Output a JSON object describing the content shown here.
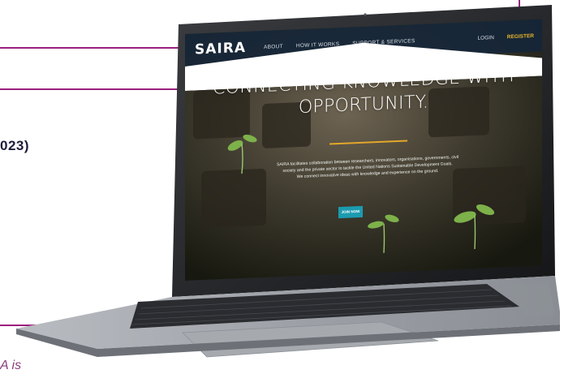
{
  "slide": {
    "year_fragment": "023)",
    "caption_fragment": "A is"
  },
  "website": {
    "logo": "SAIRA",
    "nav": {
      "items": [
        "ABOUT",
        "HOW IT WORKS",
        "SUPPORT & SERVICES"
      ],
      "login": "LOGIN",
      "register": "REGISTER"
    },
    "hero": {
      "title_line1": "CONNECTING KNOWLEDGE WITH",
      "title_line2": "OPPORTUNITY.",
      "description_line1": "SAIRA facilitates collaboration between researchers, innovators, organisations, governments, civil",
      "description_line2": "society and the private sector to tackle the United Nations Sustainable Development Goals.",
      "description_line3": "We connect innovative ideas with knowledge and experience on the ground.",
      "cta": "JOIN NOW"
    }
  },
  "colors": {
    "accent_magenta": "#9b1f7d",
    "nav_background": "#162638",
    "register_gold": "#e7b52a",
    "hero_rule_gold": "#e3a72a",
    "cta_teal": "#1b9bb0"
  }
}
